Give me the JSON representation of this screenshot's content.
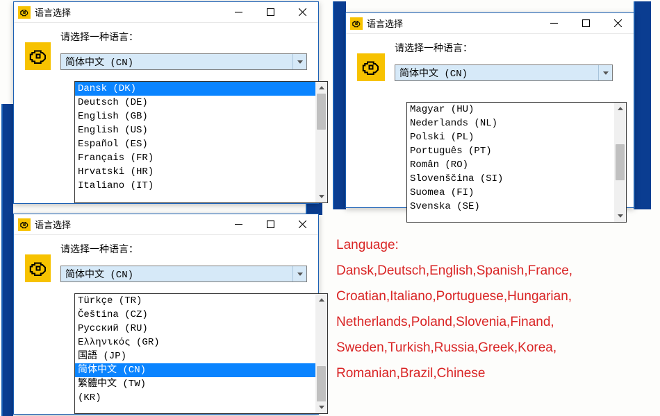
{
  "windowA": {
    "title": "语言选择",
    "prompt": "请选择一种语言：",
    "combo_value": "简体中文 (CN)",
    "items": [
      "Dansk (DK)",
      "Deutsch (DE)",
      "English (GB)",
      "English (US)",
      "Español (ES)",
      "Français (FR)",
      "Hrvatski (HR)",
      "Italiano (IT)"
    ],
    "highlight_index": 0
  },
  "windowB": {
    "title": "语言选择",
    "prompt": "请选择一种语言：",
    "combo_value": "简体中文 (CN)",
    "items": [
      "Magyar (HU)",
      "Nederlands (NL)",
      "Polski (PL)",
      "Português (PT)",
      "Român (RO)",
      "Slovenščina (SI)",
      "Suomea (FI)",
      "Svenska (SE)"
    ],
    "highlight_index": -1
  },
  "windowC": {
    "title": "语言选择",
    "prompt": "请选择一种语言：",
    "combo_value": "简体中文 (CN)",
    "items": [
      "Türkçe (TR)",
      "Čeština (CZ)",
      "Русский (RU)",
      "Ελληνικός (GR)",
      "国語 (JP)",
      "简体中文 (CN)",
      "繁體中文 (TW)",
      "       (KR)"
    ],
    "highlight_index": 5
  },
  "caption": {
    "label": "Language:",
    "lines": [
      "Dansk,Deutsch,English,Spanish,France,",
      "Croatian,Italiano,Portuguese,Hungarian,",
      "Netherlands,Poland,Slovenia,Finand,",
      "Sweden,Turkish,Russia,Greek,Korea,",
      "Romanian,Brazil,Chinese"
    ]
  }
}
